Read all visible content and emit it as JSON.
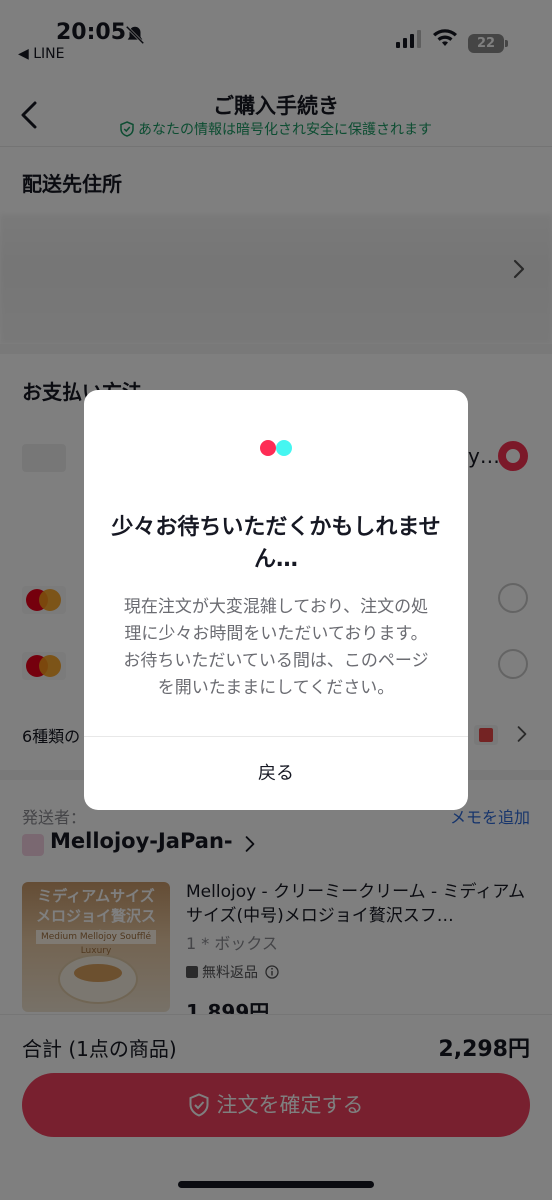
{
  "status_bar": {
    "time": "20:05",
    "back_app": "◀ LINE",
    "battery": "22"
  },
  "header": {
    "title": "ご購入手続き",
    "secure_note": "あなたの情報は暗号化され安全に保護されます"
  },
  "address": {
    "title": "配送先住所"
  },
  "payment": {
    "title": "お支払い方法",
    "first_option_tail": "y…",
    "more_label": "6種類の"
  },
  "shipper": {
    "label": "発送者：",
    "memo_link": "メモを追加",
    "shop_name": "Mellojoy-JaPan-"
  },
  "product": {
    "image_text": "ミディアムサイズ\nメロジョイ贅沢スフレ",
    "image_subtext": "Medium Mellojoy Soufflé Luxury",
    "title": "Mellojoy - クリーミークリーム - ミディアムサイズ(中号)メロジョイ贅沢スフ…",
    "quantity": "1 * ボックス",
    "free_return": "無料返品",
    "price": "1,899円"
  },
  "footer": {
    "total_label": "合計 (1点の商品)",
    "total_value": "2,298円",
    "confirm_label": "注文を確定する"
  },
  "modal": {
    "title": "少々お待ちいただくかもしれません…",
    "body": "現在注文が大変混雑しており、注文の処理に少々お時間をいただいております。お待ちいただいている間は、このページを開いたままにしてください。",
    "back_label": "戻る"
  },
  "colors": {
    "accent": "#fe2c55",
    "secure_green": "#1a9a64",
    "link_blue": "#2f6bd9"
  }
}
